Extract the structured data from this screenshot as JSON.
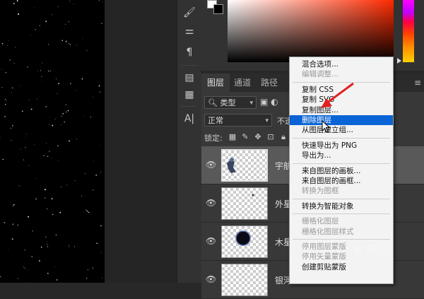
{
  "toolbar": {
    "tools": [
      {
        "icon": "brush-settings-icon",
        "glyph": "🖌"
      },
      {
        "icon": "adjustment-sliders-icon",
        "glyph": "⚌"
      },
      {
        "icon": "paragraph-icon",
        "glyph": "¶"
      },
      {
        "icon": "properties-panel-icon",
        "glyph": "▤"
      },
      {
        "icon": "document-info-icon",
        "glyph": "▦"
      },
      {
        "icon": "character-panel-icon",
        "glyph": "A|"
      }
    ]
  },
  "color_panel": {
    "foreground": "#ffffff",
    "background": "#000000",
    "field_hue_color": "#ff2a00"
  },
  "layers_panel": {
    "tabs": [
      "图层",
      "通道",
      "路径"
    ],
    "active_tab": "图层",
    "filter_select": "类型",
    "blend_mode": "正常",
    "opacity_label": "不透",
    "lock_label": "锁定:",
    "layers": [
      {
        "name": "宇航",
        "selected": true,
        "visible": true
      },
      {
        "name": "外星",
        "selected": false,
        "visible": true
      },
      {
        "name": "木星",
        "selected": false,
        "visible": true
      },
      {
        "name": "银河",
        "selected": false,
        "visible": true
      }
    ]
  },
  "context_menu": {
    "items": [
      {
        "label": "混合选项...",
        "disabled": false
      },
      {
        "label": "编辑调整...",
        "disabled": true
      },
      {
        "sep": true
      },
      {
        "label": "复制 CSS",
        "disabled": false
      },
      {
        "label": "复制 SVG",
        "disabled": false
      },
      {
        "label": "复制图层...",
        "disabled": false
      },
      {
        "label": "删除图层",
        "disabled": false,
        "highlight": true
      },
      {
        "label": "从图层建立组...",
        "disabled": false
      },
      {
        "sep": true
      },
      {
        "label": "快速导出为 PNG",
        "disabled": false
      },
      {
        "label": "导出为...",
        "disabled": false
      },
      {
        "sep": true
      },
      {
        "label": "来自图层的画板...",
        "disabled": false
      },
      {
        "label": "来自图层的画框...",
        "disabled": false
      },
      {
        "label": "转换为图框",
        "disabled": true
      },
      {
        "sep": true
      },
      {
        "label": "转换为智能对象",
        "disabled": false
      },
      {
        "sep": true
      },
      {
        "label": "栅格化图层",
        "disabled": true
      },
      {
        "label": "栅格化图层样式",
        "disabled": true
      },
      {
        "sep": true
      },
      {
        "label": "停用图层蒙版",
        "disabled": true
      },
      {
        "label": "停用矢量蒙版",
        "disabled": true
      },
      {
        "label": "创建剪贴蒙版",
        "disabled": false
      }
    ]
  },
  "watermark": {
    "text": "经验"
  },
  "colors": {
    "highlight": "#0a64d6",
    "arrow": "#e02020"
  }
}
